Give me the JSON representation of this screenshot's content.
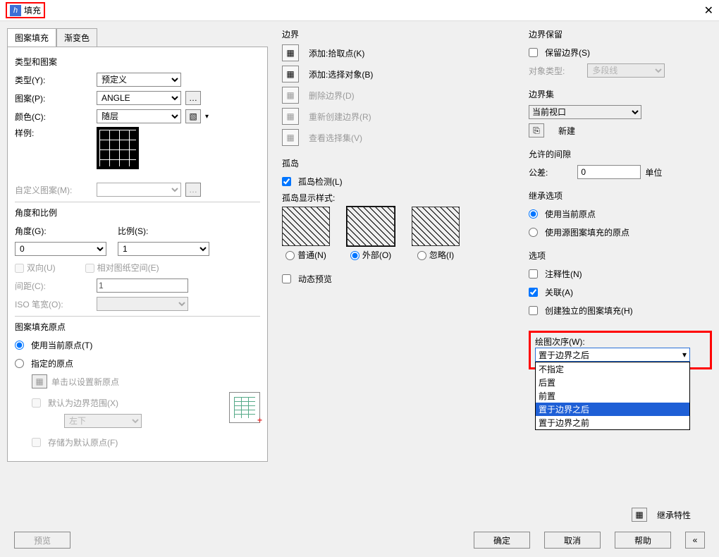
{
  "window": {
    "title": "填充"
  },
  "tabs": {
    "hatch": "图案填充",
    "gradient": "渐变色"
  },
  "typePattern": {
    "group": "类型和图案",
    "typeLbl": "类型(Y):",
    "typeVal": "预定义",
    "patternLbl": "图案(P):",
    "patternVal": "ANGLE",
    "colorLbl": "颜色(C):",
    "colorVal": "随层",
    "sampleLbl": "样例:",
    "customLbl": "自定义图案(M):"
  },
  "angleScale": {
    "group": "角度和比例",
    "angleLbl": "角度(G):",
    "angleVal": "0",
    "scaleLbl": "比例(S):",
    "scaleVal": "1",
    "bidir": "双向(U)",
    "paperSpace": "相对图纸空间(E)",
    "spacingLbl": "间距(C):",
    "spacingVal": "1",
    "isoLbl": "ISO 笔宽(O):"
  },
  "origin": {
    "group": "图案填充原点",
    "useCurrent": "使用当前原点(T)",
    "specify": "指定的原点",
    "clickNew": "单击以设置新原点",
    "defaultExt": "默认为边界范围(X)",
    "posVal": "左下",
    "storeDefault": "存储为默认原点(F)"
  },
  "boundary": {
    "group": "边界",
    "addPick": "添加:拾取点(K)",
    "addSelect": "添加:选择对象(B)",
    "remove": "删除边界(D)",
    "recreate": "重新创建边界(R)",
    "viewSel": "查看选择集(V)"
  },
  "island": {
    "group": "孤岛",
    "detect": "孤岛检测(L)",
    "styleLbl": "孤岛显示样式:",
    "normal": "普通(N)",
    "outer": "外部(O)",
    "ignore": "忽略(I)"
  },
  "dynPreview": "动态预览",
  "boundaryRetain": {
    "group": "边界保留",
    "retain": "保留边界(S)",
    "objTypeLbl": "对象类型:",
    "objTypeVal": "多段线"
  },
  "boundarySet": {
    "group": "边界集",
    "val": "当前视口",
    "newBtn": "新建"
  },
  "gap": {
    "group": "允许的间隙",
    "tolLbl": "公差:",
    "tolVal": "0",
    "unit": "单位"
  },
  "inherit": {
    "group": "继承选项",
    "useCurrent": "使用当前原点",
    "useSource": "使用源图案填充的原点"
  },
  "options": {
    "group": "选项",
    "annotative": "注释性(N)",
    "assoc": "关联(A)",
    "separate": "创建独立的图案填充(H)",
    "drawOrderLbl": "绘图次序(W):",
    "drawOrderVal": "置于边界之后",
    "ddItems": [
      "不指定",
      "后置",
      "前置",
      "置于边界之后",
      "置于边界之前"
    ]
  },
  "inheritProps": "继承特性",
  "footer": {
    "preview": "预览",
    "ok": "确定",
    "cancel": "取消",
    "help": "帮助"
  }
}
